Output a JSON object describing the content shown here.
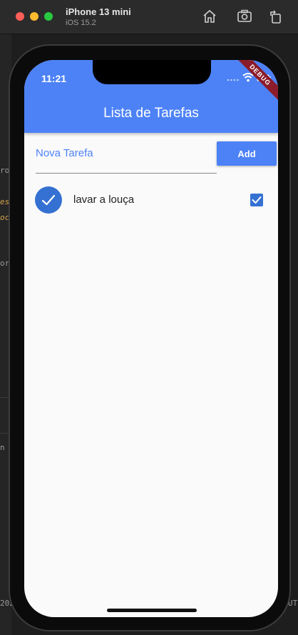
{
  "window": {
    "device_name": "iPhone 13 mini",
    "os_version": "iOS 15.2"
  },
  "background": {
    "fragments": [
      "ro",
      "es",
      "oc",
      "or",
      "n",
      "202",
      "UT"
    ]
  },
  "status_bar": {
    "time": "11:21"
  },
  "debug_banner": "DEBUG",
  "app": {
    "title": "Lista de Tarefas",
    "new_task": {
      "placeholder": "Nova Tarefa",
      "value": ""
    },
    "add_label": "Add",
    "tasks": [
      {
        "label": "lavar a louça",
        "done": true
      }
    ]
  },
  "colors": {
    "primary": "#4d82f6",
    "avatar": "#3571d2",
    "debug_banner": "#8b1c2b"
  }
}
